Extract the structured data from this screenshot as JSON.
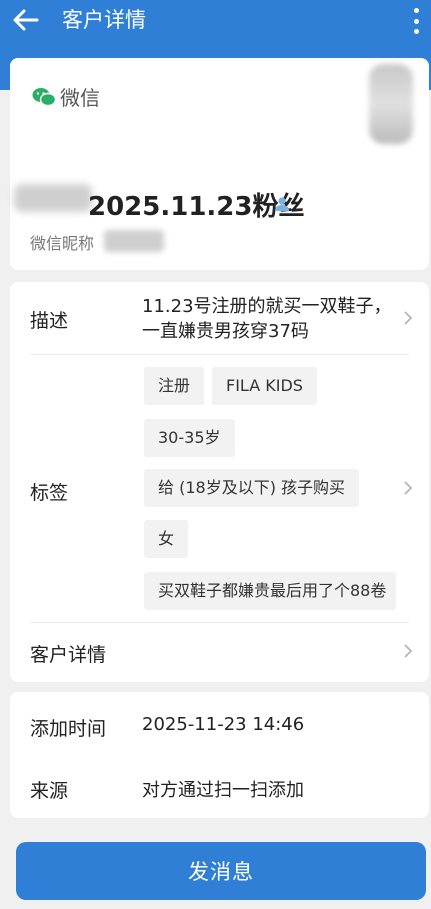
{
  "header": {
    "title": "客户详情"
  },
  "profile": {
    "source_label": "微信",
    "fan_title": "2025.11.23粉丝",
    "nickname_label": "微信昵称"
  },
  "description": {
    "label": "描述",
    "text": "11.23号注册的就买一双鞋子，一直嫌贵男孩穿37码"
  },
  "tags": {
    "label": "标签",
    "items": [
      "注册",
      "FILA KIDS",
      "30-35岁",
      "给 (18岁及以下) 孩子购买",
      "女",
      "买双鞋子都嫌贵最后用了个88卷"
    ]
  },
  "customer_detail": {
    "label": "客户详情"
  },
  "add_time": {
    "label": "添加时间",
    "value": "2025-11-23 14:46"
  },
  "source": {
    "label": "来源",
    "value": "对方通过扫一扫添加"
  },
  "send_button": {
    "label": "发消息"
  },
  "colors": {
    "brand": "#2f7fd6",
    "wechat": "#2aae67",
    "icon": "#7ab0e0"
  }
}
